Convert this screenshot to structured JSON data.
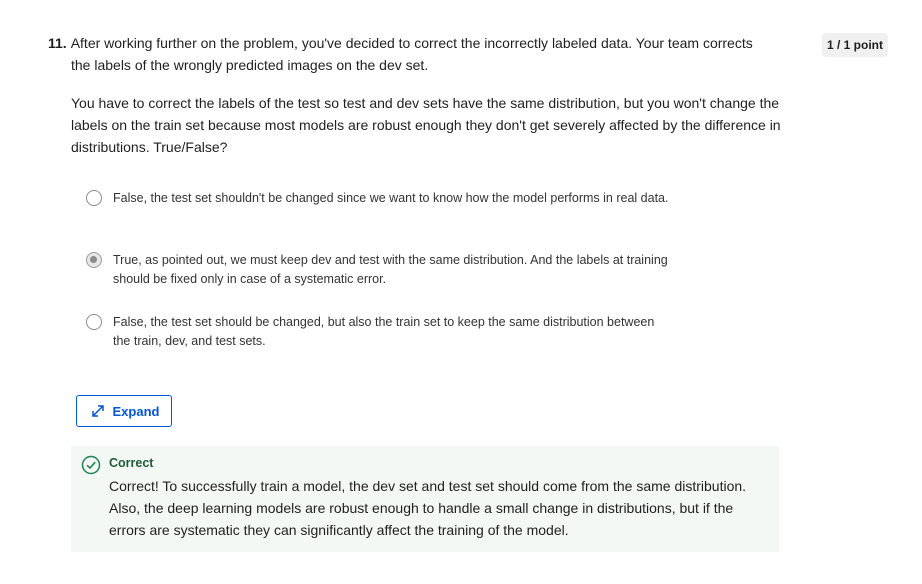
{
  "question": {
    "number": "11.",
    "heading_line1": "After working further on the problem, you've decided to correct the incorrectly labeled data. Your team corrects",
    "heading_line2": "the labels of the wrongly predicted images on the dev set.",
    "body": "You have to correct the labels of the test so test and dev sets have the same distribution, but you won't change the labels on the train set because most models are robust enough they don't get severely affected by the difference in distributions. True/False?",
    "points": "1 / 1 point"
  },
  "options": [
    {
      "text": "False, the test set shouldn't be changed since we want to know how the model performs in real data.",
      "selected": false
    },
    {
      "text": "True, as pointed out, we must keep dev and test with the same distribution. And the labels at training should be fixed only in case of a systematic error.",
      "selected": true
    },
    {
      "text": "False, the test set should be changed, but also the train set to keep the same distribution between the train, dev, and test sets.",
      "selected": false
    }
  ],
  "expand": {
    "label": "Expand",
    "icon": "expand-arrows-icon"
  },
  "feedback": {
    "status": "Correct",
    "text": "Correct! To successfully train a model, the dev set and test set should come from the same distribution. Also, the deep learning models are robust enough to handle a small change in distributions, but if the errors are systematic they can significantly affect the training of the model.",
    "icon": "check-circle-icon"
  },
  "colors": {
    "accent": "#0056d2",
    "success": "#1f8354",
    "feedback_bg": "#f3f8f5"
  }
}
